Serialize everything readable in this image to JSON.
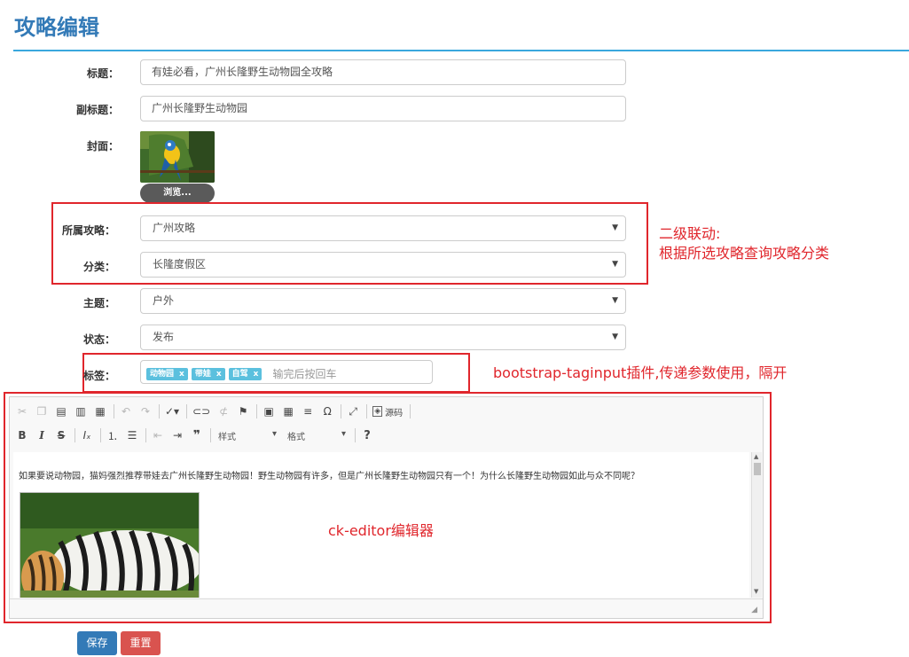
{
  "page": {
    "title": "攻略编辑"
  },
  "form": {
    "title": {
      "label": "标题：",
      "value": "有娃必看，广州长隆野生动物园全攻略"
    },
    "subtitle": {
      "label": "副标题：",
      "value": "广州长隆野生动物园"
    },
    "cover": {
      "label": "封面：",
      "browse_label": "浏览..."
    },
    "guide": {
      "label": "所属攻略：",
      "value": "广州攻略"
    },
    "category": {
      "label": "分类：",
      "value": "长隆度假区"
    },
    "theme": {
      "label": "主题：",
      "value": "户外"
    },
    "status": {
      "label": "状态：",
      "value": "发布"
    },
    "tags": {
      "label": "标签：",
      "items": [
        "动物园",
        "带娃",
        "自驾"
      ],
      "remove_glyph": "x",
      "placeholder": "输完后按回车"
    }
  },
  "editor": {
    "source_label": "源码",
    "style_combo": "样式",
    "format_combo": "格式",
    "content_text": "如果要说动物园，猫妈强烈推荐带娃去广州长隆野生动物园！野生动物园有许多，但是广州长隆野生动物园只有一个！为什么长隆野生动物园如此与众不同呢？"
  },
  "annotations": {
    "cascade_line1": "二级联动:",
    "cascade_line2": "根据所选攻略查询攻略分类",
    "taginput": "bootstrap-taginput插件,传递参数使用，隔开",
    "ckeditor": "ck-editor编辑器"
  },
  "actions": {
    "save_label": "保存",
    "reset_label": "重置"
  },
  "colors": {
    "accent": "#337ab7",
    "danger": "#d9534f",
    "annotation": "#e0262c",
    "tag": "#5bc0de"
  }
}
